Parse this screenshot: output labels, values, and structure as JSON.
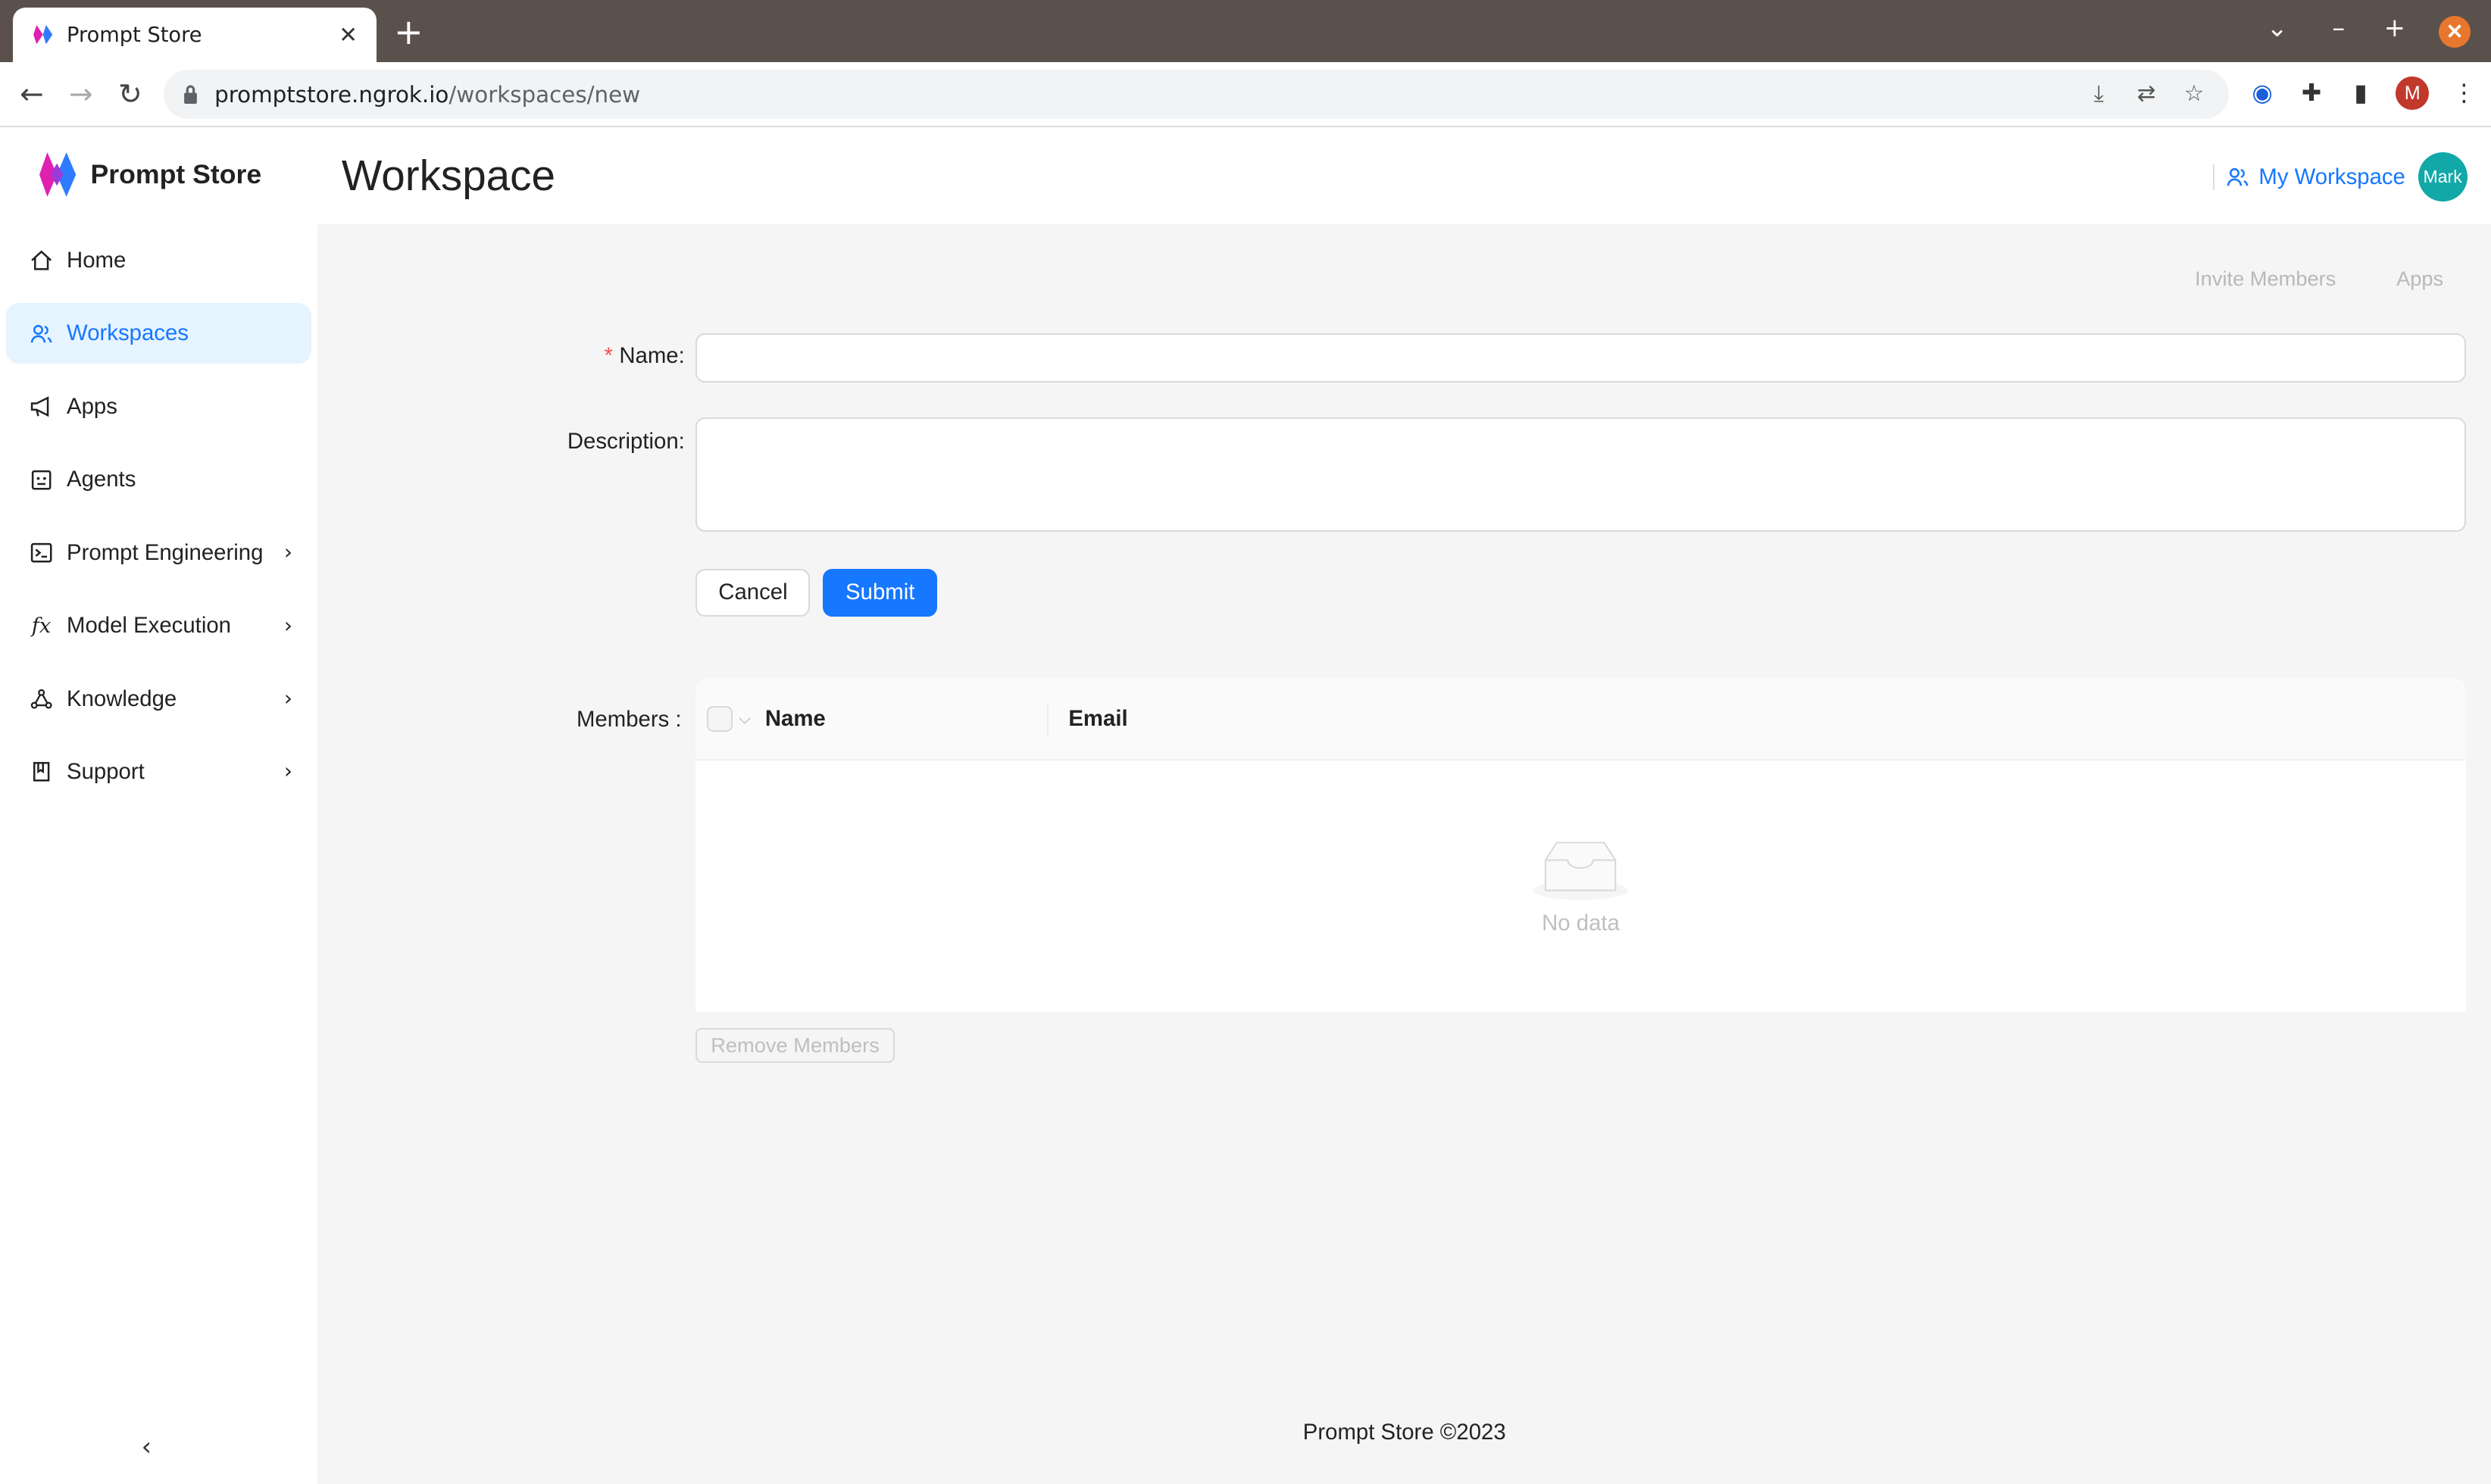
{
  "browser": {
    "tab_title": "Prompt Store",
    "url_host": "promptstore.ngrok.io",
    "url_path": "/workspaces/new",
    "profile_initial": "M"
  },
  "sidebar": {
    "brand": "Prompt Store",
    "items": [
      {
        "label": "Home",
        "icon": "home-icon",
        "active": false,
        "submenu": false
      },
      {
        "label": "Workspaces",
        "icon": "team-icon",
        "active": true,
        "submenu": false
      },
      {
        "label": "Apps",
        "icon": "megaphone-icon",
        "active": false,
        "submenu": false
      },
      {
        "label": "Agents",
        "icon": "robot-icon",
        "active": false,
        "submenu": false
      },
      {
        "label": "Prompt Engineering",
        "icon": "terminal-icon",
        "active": false,
        "submenu": true
      },
      {
        "label": "Model Execution",
        "icon": "function-icon",
        "active": false,
        "submenu": true
      },
      {
        "label": "Knowledge",
        "icon": "nodes-icon",
        "active": false,
        "submenu": true
      },
      {
        "label": "Support",
        "icon": "book-icon",
        "active": false,
        "submenu": true
      }
    ]
  },
  "header": {
    "title": "Workspace",
    "workspace_link": "My Workspace",
    "avatar_text": "Mark"
  },
  "actions": {
    "invite": "Invite Members",
    "apps": "Apps"
  },
  "form": {
    "name_label": "Name",
    "name_value": "",
    "description_label": "Description",
    "description_value": "",
    "cancel": "Cancel",
    "submit": "Submit",
    "members_label": "Members :"
  },
  "table": {
    "columns": [
      "Name",
      "Email"
    ],
    "empty_text": "No data",
    "remove_button": "Remove Members"
  },
  "footer": "Prompt Store ©2023",
  "colors": {
    "primary": "#1677ff",
    "avatar": "#13a8a8",
    "tabbar": "#5b514c"
  }
}
